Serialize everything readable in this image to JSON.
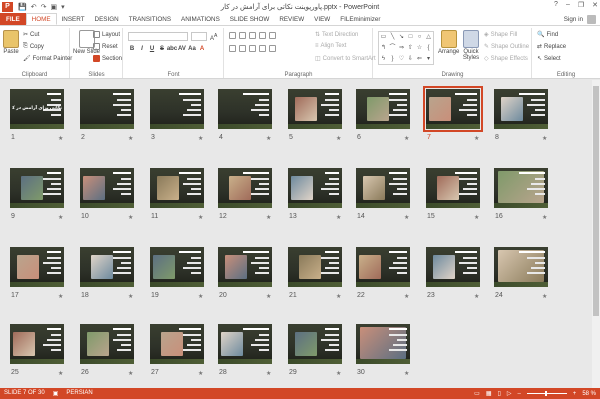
{
  "titlebar": {
    "app_icon": "P",
    "title": "پاورپوینت نکاتی برای آرامش در کار.pptx - PowerPoint",
    "help": "?",
    "minimize": "–",
    "restore": "❐",
    "close": "✕"
  },
  "tabs": {
    "file": "FILE",
    "items": [
      "HOME",
      "INSERT",
      "DESIGN",
      "TRANSITIONS",
      "ANIMATIONS",
      "SLIDE SHOW",
      "REVIEW",
      "VIEW",
      "FILEminimizer"
    ],
    "sign_in": "Sign in"
  },
  "ribbon": {
    "clipboard": {
      "paste": "Paste",
      "cut": "Cut",
      "copy": "Copy",
      "format_painter": "Format Painter",
      "label": "Clipboard"
    },
    "slides": {
      "new_slide": "New Slide",
      "layout": "Layout",
      "reset": "Reset",
      "section": "Section",
      "label": "Slides"
    },
    "font": {
      "label": "Font",
      "bold": "B",
      "italic": "I",
      "underline": "U",
      "strike": "S",
      "shadow": "abc",
      "spacing": "AV",
      "case": "Aa",
      "color": "A"
    },
    "paragraph": {
      "text_direction": "Text Direction",
      "align_text": "Align Text",
      "convert_smartart": "Convert to SmartArt",
      "label": "Paragraph"
    },
    "drawing": {
      "arrange": "Arrange",
      "quick_styles": "Quick Styles",
      "shape_fill": "Shape Fill",
      "shape_outline": "Shape Outline",
      "shape_effects": "Shape Effects",
      "label": "Drawing"
    },
    "editing": {
      "find": "Find",
      "replace": "Replace",
      "select": "Select",
      "label": "Editing"
    }
  },
  "slides": [
    {
      "num": "1",
      "title": "نکاتی برای آرامش در کار"
    },
    {
      "num": "2"
    },
    {
      "num": "3"
    },
    {
      "num": "4"
    },
    {
      "num": "5"
    },
    {
      "num": "6"
    },
    {
      "num": "7",
      "selected": true
    },
    {
      "num": "8"
    },
    {
      "num": "9"
    },
    {
      "num": "10"
    },
    {
      "num": "11"
    },
    {
      "num": "12"
    },
    {
      "num": "13"
    },
    {
      "num": "14"
    },
    {
      "num": "15"
    },
    {
      "num": "16"
    },
    {
      "num": "17"
    },
    {
      "num": "18"
    },
    {
      "num": "19"
    },
    {
      "num": "20"
    },
    {
      "num": "21"
    },
    {
      "num": "22"
    },
    {
      "num": "23"
    },
    {
      "num": "24"
    },
    {
      "num": "25"
    },
    {
      "num": "26"
    },
    {
      "num": "27"
    },
    {
      "num": "28"
    },
    {
      "num": "29"
    },
    {
      "num": "30"
    }
  ],
  "status": {
    "slide_of": "SLIDE 7 OF 30",
    "language": "PERSIAN",
    "zoom_minus": "–",
    "zoom_plus": "+",
    "zoom": "58 %"
  },
  "colors": {
    "accent": "#d24726",
    "sorter_bg": "#e8e8e8"
  }
}
